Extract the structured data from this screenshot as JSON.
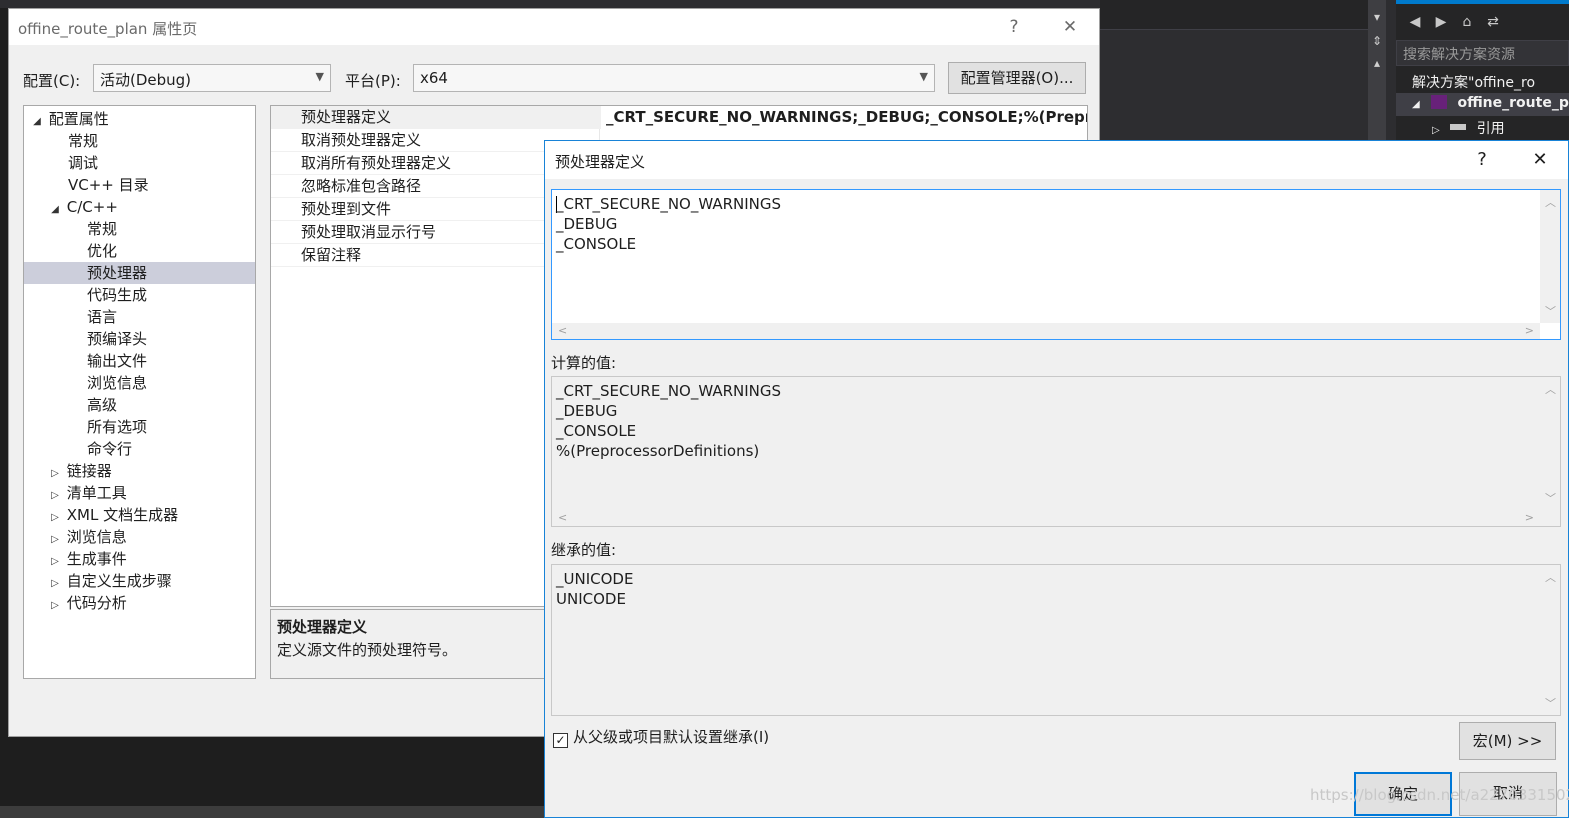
{
  "property_window": {
    "title": "offine_route_plan 属性页",
    "help_glyph": "?",
    "close_glyph": "✕",
    "config_label": "配置(C):",
    "config_value": "活动(Debug)",
    "platform_label": "平台(P):",
    "platform_value": "x64",
    "config_manager_button": "配置管理器(O)...",
    "tree": {
      "root": "配置属性",
      "general": "常规",
      "debugging": "调试",
      "vc_dirs": "VC++ 目录",
      "cpp": "C/C++",
      "cpp_general": "常规",
      "optimization": "优化",
      "preprocessor": "预处理器",
      "code_generation": "代码生成",
      "language": "语言",
      "precompiled_headers": "预编译头",
      "output_files": "输出文件",
      "browse_info": "浏览信息",
      "advanced": "高级",
      "all_options": "所有选项",
      "command_line": "命令行",
      "linker": "链接器",
      "manifest_tool": "清单工具",
      "xml_doc_gen": "XML 文档生成器",
      "browse_information": "浏览信息",
      "build_events": "生成事件",
      "custom_build_step": "自定义生成步骤",
      "code_analysis": "代码分析"
    },
    "grid": {
      "rows": [
        {
          "name": "预处理器定义",
          "value": "_CRT_SECURE_NO_WARNINGS;_DEBUG;_CONSOLE;%(Preprocess"
        },
        {
          "name": "取消预处理器定义",
          "value": ""
        },
        {
          "name": "取消所有预处理器定义",
          "value": ""
        },
        {
          "name": "忽略标准包含路径",
          "value": ""
        },
        {
          "name": "预处理到文件",
          "value": ""
        },
        {
          "name": "预处理取消显示行号",
          "value": ""
        },
        {
          "name": "保留注释",
          "value": ""
        }
      ]
    },
    "description": {
      "title": "预处理器定义",
      "text": "定义源文件的预处理符号。"
    }
  },
  "dialog": {
    "title": "预处理器定义",
    "help_glyph": "?",
    "close_glyph": "✕",
    "definitions_text": "_CRT_SECURE_NO_WARNINGS\n_DEBUG\n_CONSOLE",
    "evaluated_label": "计算的值:",
    "evaluated_text": "_CRT_SECURE_NO_WARNINGS\n_DEBUG\n_CONSOLE\n%(PreprocessorDefinitions)",
    "inherited_label": "继承的值:",
    "inherited_text": "_UNICODE\nUNICODE",
    "inherit_checkbox_label": "从父级或项目默认设置继承(I)",
    "inherit_checked": true,
    "check_glyph": "✓",
    "macros_button": "宏(M) >>",
    "ok_button": "确定",
    "cancel_button": "取消"
  },
  "solution_explorer": {
    "search_placeholder": "搜索解决方案资源",
    "solution_row": "解决方案\"offine_ro",
    "project_row": "offine_route_p",
    "references_row": "引用"
  },
  "icons": {
    "back": "◀",
    "forward": "▶",
    "home": "⌂",
    "sync": "⇄",
    "collapsed": "▷",
    "expanded": "◢"
  },
  "watermark": "https://blog.csdn.net/a2270331502",
  "colors": {
    "accent": "#0078d7",
    "ide_dark": "#2d2d30",
    "selection": "#cccedb"
  }
}
